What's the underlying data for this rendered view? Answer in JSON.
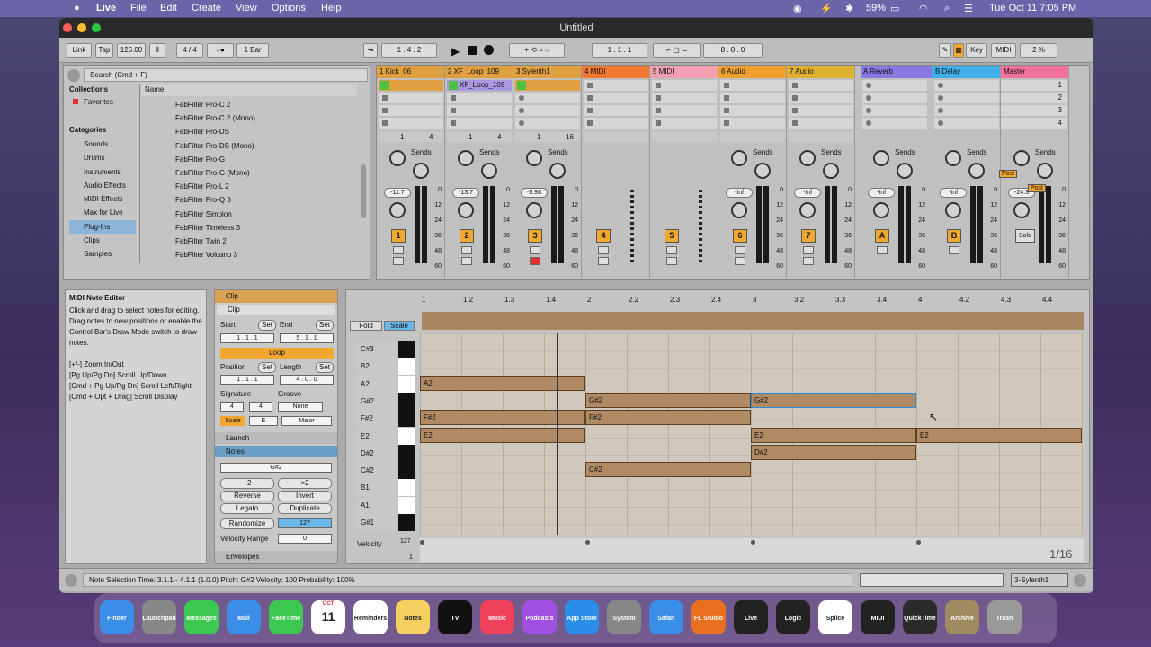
{
  "menubar": {
    "apple": "",
    "items": [
      "Live",
      "File",
      "Edit",
      "Create",
      "View",
      "Options",
      "Help"
    ],
    "battery": "59%",
    "datetime": "Tue Oct 11  7:05 PM"
  },
  "window": {
    "title": "Untitled"
  },
  "control_bar": {
    "link": "Link",
    "tap": "Tap",
    "tempo": "126.00",
    "signature": "4 / 4",
    "quantize": "1 Bar",
    "position": "1 . 4 . 2",
    "loop_start": "1 . 1 . 1",
    "loop_length": "8 . 0 . 0",
    "key": "Key",
    "midi": "MIDI",
    "cpu": "2 %"
  },
  "browser": {
    "search_placeholder": "Search (Cmd + F)",
    "collections_header": "Collections",
    "favorites": "Favorites",
    "categories_header": "Categories",
    "categories": [
      "Sounds",
      "Drums",
      "Instruments",
      "Audio Effects",
      "MIDI Effects",
      "Max for Live",
      "Plug-Ins",
      "Clips",
      "Samples"
    ],
    "name_header": "Name",
    "items": [
      "FabFilter Pro-C 2",
      "FabFilter Pro-C 2 (Mono)",
      "FabFilter Pro-DS",
      "FabFilter Pro-DS (Mono)",
      "FabFilter Pro-G",
      "FabFilter Pro-G (Mono)",
      "FabFilter Pro-L 2",
      "FabFilter Pro-Q 3",
      "FabFilter Simplon",
      "FabFilter Timeless 3",
      "FabFilter Twin 2",
      "FabFilter Volcano 3"
    ]
  },
  "tracks": [
    {
      "name": "1 Kick_06",
      "color": "#e0a040",
      "volume": "-11.7",
      "number": "1",
      "routing": "1",
      "out": "4"
    },
    {
      "name": "2 XF_Loop_109",
      "color": "#e0a040",
      "clip": "XF_Loop_109",
      "volume": "-13.7",
      "number": "2",
      "routing": "1",
      "out": "4"
    },
    {
      "name": "3 Sylenth1",
      "color": "#e0a040",
      "volume": "-5.98",
      "number": "3",
      "routing": "1",
      "out": "16"
    },
    {
      "name": "4 MIDI",
      "color": "#f07830",
      "volume": "",
      "number": "4"
    },
    {
      "name": "5 MIDI",
      "color": "#f0a0b0",
      "volume": "",
      "number": "5"
    },
    {
      "name": "6 Audio",
      "color": "#f0a030",
      "volume": "-Inf",
      "number": "6"
    },
    {
      "name": "7 Audio",
      "color": "#e0b030",
      "volume": "-Inf",
      "number": "7"
    },
    {
      "name": "A Reverb",
      "color": "#8878e0",
      "volume": "-Inf",
      "number": "A"
    },
    {
      "name": "B Delay",
      "color": "#40b0e8",
      "volume": "-Inf",
      "number": "B"
    },
    {
      "name": "Master",
      "color": "#f070a0",
      "volume": "-24.3",
      "number": "Solo"
    }
  ],
  "mixer": {
    "sends": "Sends",
    "scale": [
      "0",
      "12",
      "24",
      "36",
      "48",
      "60"
    ],
    "scenes": [
      "1",
      "2",
      "3",
      "4"
    ],
    "post": "Post"
  },
  "info": {
    "title": "MIDI Note Editor",
    "body": "Click and drag to select notes for editing. Drag notes to new positions or enable the Control Bar's Draw Mode switch to draw notes.",
    "shortcuts": [
      "[+/-] Zoom In/Out",
      "[Pg Up/Pg Dn] Scroll Up/Down",
      "[Cmd + Pg Up/Pg Dn] Scroll Left/Right",
      "[Cmd + Opt + Drag] Scroll Display"
    ]
  },
  "clip_panel": {
    "header": "Clip",
    "clip_name": "Clip",
    "start": "Start",
    "end": "End",
    "set": "Set",
    "start_val": "1 . 1 . 1",
    "end_val": "5 . 1 . 1",
    "loop": "Loop",
    "position": "Position",
    "length": "Length",
    "pos_val": "1 . 1 . 1",
    "len_val": "4 . 0 . 0",
    "signature": "Signature",
    "groove": "Groove",
    "sig_num": "4",
    "sig_den": "4",
    "groove_val": "None",
    "scale": "Scale",
    "scale_root": "E",
    "scale_mode": "Major",
    "launch": "Launch",
    "notes": "Notes",
    "note_name": "G#2",
    "half": "÷2",
    "double": "×2",
    "reverse": "Reverse",
    "invert": "Invert",
    "legato": "Legato",
    "duplicate": "Duplicate",
    "randomize": "Randomize",
    "rand_val": "127",
    "vel_range": "Velocity Range",
    "vel_range_val": "0",
    "envelopes": "Envelopes"
  },
  "editor": {
    "fold": "Fold",
    "scale": "Scale",
    "ruler": [
      "1",
      "1.2",
      "1.3",
      "1.4",
      "2",
      "2.2",
      "2.3",
      "2.4",
      "3",
      "3.2",
      "3.3",
      "3.4",
      "4",
      "4.2",
      "4.3",
      "4.4"
    ],
    "keys": [
      "C#3",
      "B2",
      "A2",
      "G#2",
      "F#2",
      "E2",
      "D#2",
      "C#2",
      "B1",
      "A1",
      "G#1"
    ],
    "notes": [
      "A2",
      "F#2",
      "E2",
      "G#2",
      "F#2",
      "C#2",
      "G#2",
      "E2",
      "D#2",
      "E2"
    ],
    "velocity": "Velocity",
    "vel_max": "127",
    "vel_min": "1",
    "grid": "1/16"
  },
  "status": {
    "text": "Note Selection   Time: 3.1.1 - 4.1.1 (1.0.0)   Pitch: G#2   Velocity: 100   Probability: 100%",
    "track": "3-Sylenth1"
  },
  "dock": [
    "Finder",
    "Launchpad",
    "Messages",
    "Mail",
    "FaceTime",
    "Calendar",
    "Reminders",
    "Notes",
    "TV",
    "Music",
    "Podcasts",
    "App Store",
    "System Preferences",
    "Safari",
    "FL Studio",
    "Live",
    "Logic",
    "Splice",
    "MIDI",
    "QuickTime",
    "Archive",
    "Trash"
  ],
  "calendar": {
    "month": "OCT",
    "day": "11"
  }
}
